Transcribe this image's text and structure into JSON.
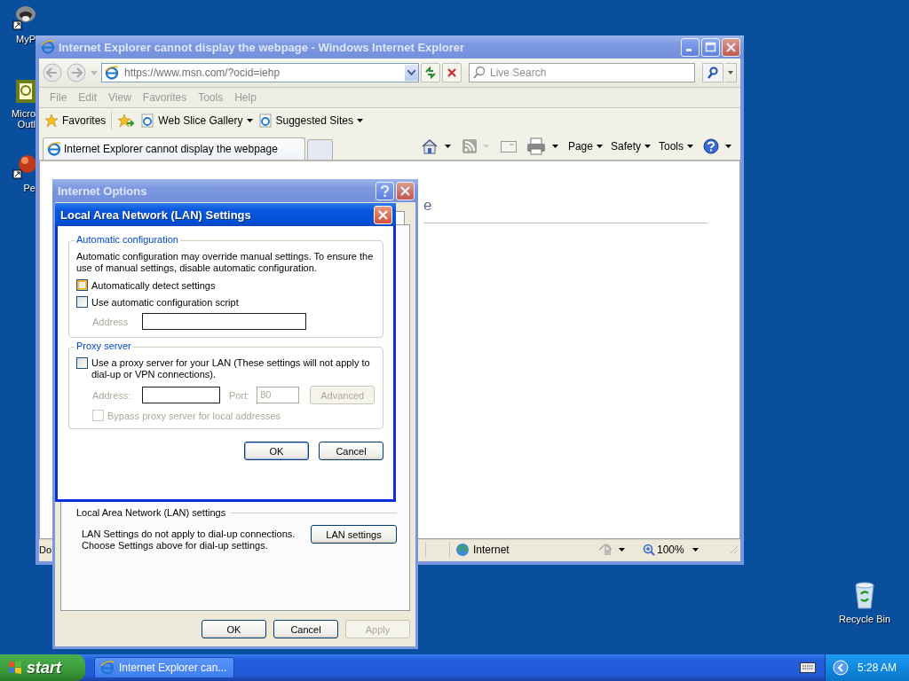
{
  "desktop": {
    "icons": [
      {
        "label": "MyP",
        "kind": "app"
      },
      {
        "label": "Micro Outl",
        "kind": "mail"
      },
      {
        "label": "Pe",
        "kind": "ball"
      }
    ],
    "recycle_bin": {
      "label": "Recycle Bin"
    }
  },
  "ie_window": {
    "title": "Internet Explorer cannot display the webpage - Windows Internet Explorer",
    "address": "https://www.msn.com/?ocid=iehp",
    "search": {
      "placeholder": "Live Search"
    },
    "menu": [
      "File",
      "Edit",
      "View",
      "Favorites",
      "Tools",
      "Help"
    ],
    "favorites_bar": [
      {
        "label": "Favorites",
        "kind": "favorites"
      },
      {
        "label": "Web Slice Gallery",
        "kind": "link"
      },
      {
        "label": "Suggested Sites",
        "kind": "link"
      }
    ],
    "tabs": [
      {
        "label": "Internet Explorer cannot display the webpage",
        "selected": true
      }
    ],
    "command_bar": [
      "Page",
      "Safety",
      "Tools"
    ],
    "page_heading": "e",
    "status_bar": {
      "text": "Do",
      "zone": "Internet",
      "zoom": "100%"
    }
  },
  "internet_options": {
    "title": "Internet Options",
    "lan_group": {
      "title": "Local Area Network (LAN) settings",
      "lines": [
        "LAN Settings do not apply to dial-up connections.",
        "Choose Settings above for dial-up settings."
      ],
      "button": "LAN settings"
    },
    "buttons": [
      {
        "label": "OK",
        "disabled": false
      },
      {
        "label": "Cancel",
        "disabled": false
      },
      {
        "label": "Apply",
        "disabled": true
      }
    ]
  },
  "lan_dialog": {
    "title": "Local Area Network (LAN) Settings",
    "automatic": {
      "title": "Automatic configuration",
      "text": "Automatic configuration may override manual settings.  To ensure the use of manual settings, disable automatic configuration.",
      "options": [
        {
          "label": "Automatically detect settings",
          "checked": false,
          "hovered": true
        },
        {
          "label": "Use automatic configuration script",
          "checked": false,
          "hovered": false
        }
      ],
      "address_label": "Address"
    },
    "proxy": {
      "title": "Proxy server",
      "option": {
        "label": "Use a proxy server for your LAN (These settings will not apply to dial-up or VPN connections).",
        "checked": false
      },
      "address_label": "Address:",
      "port_label": "Port:",
      "port_value": "80",
      "disabled": true,
      "advanced": "Advanced",
      "bypass": {
        "label": "Bypass proxy server for local addresses",
        "checked": false
      }
    },
    "buttons": [
      "OK",
      "Cancel"
    ]
  },
  "taskbar": {
    "start": "start",
    "tasks": [
      {
        "label": "Internet Explorer can...",
        "selected": false
      }
    ],
    "clock": "5:28 AM"
  }
}
